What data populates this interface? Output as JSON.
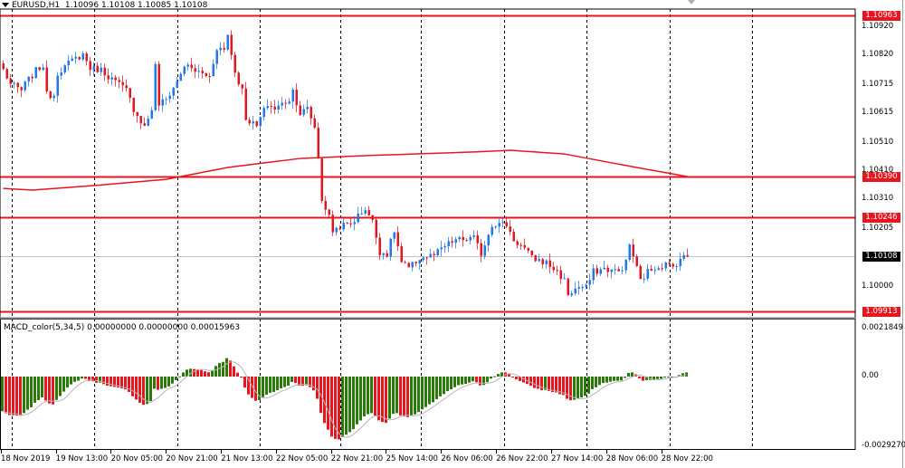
{
  "header": {
    "symbol": "EURUSD,H1",
    "open": "1.10096",
    "high": "1.10108",
    "low": "1.10085",
    "close": "1.10108",
    "menu_icon": "triangle-down-icon"
  },
  "indicator": {
    "label": "MACD_color(5,34,5) 0.00000000 0.00000000 0.00015963",
    "ticks": [
      "0.0021849",
      "0.00",
      "-0.0029270"
    ],
    "range": [
      -0.002927,
      0.0021849
    ],
    "colors": {
      "up": "#2a7a0a",
      "down": "#e8141e",
      "signal": "#b4b4b4"
    }
  },
  "price_axis": {
    "ticks": [
      "1.10920",
      "1.10820",
      "1.10715",
      "1.10615",
      "1.10510",
      "1.10410",
      "1.10310",
      "1.10205",
      "1.10000",
      "1.09900"
    ],
    "tick_values": [
      1.1092,
      1.1082,
      1.10715,
      1.10615,
      1.1051,
      1.1041,
      1.1031,
      1.10205,
      1.1,
      1.099
    ]
  },
  "levels": [
    {
      "price": 1.10963,
      "label": "1.10963",
      "color": "#e8141e"
    },
    {
      "price": 1.1039,
      "label": "1.10390",
      "color": "#e8141e"
    },
    {
      "price": 1.10246,
      "label": "1.10246",
      "color": "#e8141e"
    },
    {
      "price": 1.09913,
      "label": "1.09913",
      "color": "#e8141e"
    }
  ],
  "current_price": {
    "price": 1.10108,
    "label": "1.10108",
    "color": "#000000"
  },
  "time_axis": [
    "18 Nov 2019",
    "19 Nov 13:00",
    "20 Nov 05:00",
    "20 Nov 21:00",
    "21 Nov 13:00",
    "22 Nov 05:00",
    "22 Nov 21:00",
    "25 Nov 14:00",
    "26 Nov 06:00",
    "26 Nov 22:00",
    "27 Nov 14:00",
    "28 Nov 06:00",
    "28 Nov 22:00"
  ],
  "colors": {
    "bull": "#1e78f0",
    "bear": "#e8141e",
    "ma": "#e8141e",
    "grid": "#000000"
  },
  "chart_data": {
    "type": "candlestick",
    "bars": 190,
    "price_path_keypoints": [
      [
        0,
        1.10769
      ],
      [
        2,
        1.10718
      ],
      [
        5,
        1.10696
      ],
      [
        6,
        1.10718
      ],
      [
        9,
        1.10766
      ],
      [
        11,
        1.10785
      ],
      [
        12,
        1.1068
      ],
      [
        14,
        1.1068
      ],
      [
        15,
        1.1076
      ],
      [
        19,
        1.10801
      ],
      [
        22,
        1.10824
      ],
      [
        24,
        1.10776
      ],
      [
        27,
        1.10769
      ],
      [
        29,
        1.10747
      ],
      [
        34,
        1.10696
      ],
      [
        36,
        1.10631
      ],
      [
        39,
        1.10567
      ],
      [
        41,
        1.10631
      ],
      [
        42,
        1.10782
      ],
      [
        43,
        1.10647
      ],
      [
        45,
        1.10664
      ],
      [
        48,
        1.10728
      ],
      [
        50,
        1.10785
      ],
      [
        54,
        1.1076
      ],
      [
        57,
        1.10744
      ],
      [
        59,
        1.10849
      ],
      [
        61,
        1.1084
      ],
      [
        62,
        1.10894
      ],
      [
        64,
        1.1076
      ],
      [
        66,
        1.10696
      ],
      [
        67,
        1.10599
      ],
      [
        70,
        1.10567
      ],
      [
        71,
        1.10599
      ],
      [
        73,
        1.10647
      ],
      [
        75,
        1.10631
      ],
      [
        79,
        1.10664
      ],
      [
        80,
        1.10696
      ],
      [
        82,
        1.10615
      ],
      [
        84,
        1.10631
      ],
      [
        86,
        1.10567
      ],
      [
        87,
        1.10455
      ],
      [
        88,
        1.10311
      ],
      [
        90,
        1.10247
      ],
      [
        91,
        1.10199
      ],
      [
        93,
        1.10215
      ],
      [
        96,
        1.10224
      ],
      [
        100,
        1.10279
      ],
      [
        102,
        1.10231
      ],
      [
        104,
        1.10125
      ],
      [
        106,
        1.10118
      ],
      [
        108,
        1.10199
      ],
      [
        110,
        1.10086
      ],
      [
        112,
        1.10064
      ],
      [
        115,
        1.10102
      ],
      [
        119,
        1.10112
      ],
      [
        122,
        1.10144
      ],
      [
        125,
        1.10167
      ],
      [
        127,
        1.10167
      ],
      [
        130,
        1.10173
      ],
      [
        132,
        1.10118
      ],
      [
        135,
        1.10224
      ],
      [
        139,
        1.10221
      ],
      [
        141,
        1.10167
      ],
      [
        144,
        1.10135
      ],
      [
        146,
        1.10102
      ],
      [
        150,
        1.10086
      ],
      [
        153,
        1.10054
      ],
      [
        155,
        1.10022
      ],
      [
        156,
        1.09974
      ],
      [
        159,
        1.1
      ],
      [
        161,
        1.09997
      ],
      [
        163,
        1.10054
      ],
      [
        166,
        1.10064
      ],
      [
        170,
        1.10054
      ],
      [
        172,
        1.10086
      ],
      [
        173,
        1.10151
      ],
      [
        174,
        1.1011
      ],
      [
        176,
        1.10022
      ],
      [
        178,
        1.10054
      ],
      [
        180,
        1.1007
      ],
      [
        183,
        1.1008
      ],
      [
        185,
        1.1007
      ],
      [
        187,
        1.10102
      ],
      [
        189,
        1.10108
      ]
    ],
    "ma_keypoints": [
      [
        0,
        1.10349
      ],
      [
        8,
        1.10343
      ],
      [
        25,
        1.10359
      ],
      [
        45,
        1.10381
      ],
      [
        62,
        1.10423
      ],
      [
        82,
        1.10455
      ],
      [
        100,
        1.10465
      ],
      [
        130,
        1.10478
      ],
      [
        140,
        1.10484
      ],
      [
        155,
        1.10471
      ],
      [
        175,
        1.10423
      ],
      [
        189,
        1.10391
      ]
    ]
  }
}
